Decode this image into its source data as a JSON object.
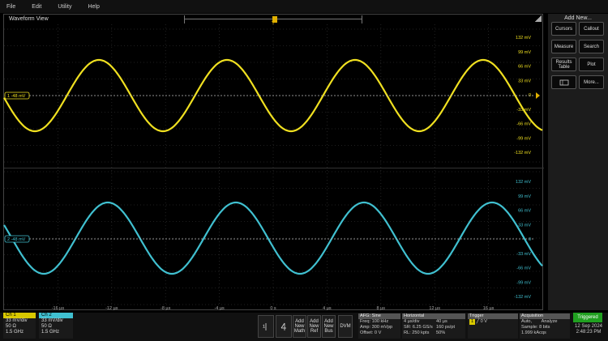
{
  "menu": [
    "File",
    "Edit",
    "Utility",
    "Help"
  ],
  "waveform_view": {
    "title": "Waveform View"
  },
  "ch1_axis": [
    "132 mV",
    "99 mV",
    "66 mV",
    "33 mV",
    "0",
    "-33 mV",
    "-66 mV",
    "-99 mV",
    "-132 mV"
  ],
  "ch2_axis": [
    "132 mV",
    "99 mV",
    "66 mV",
    "33 mV",
    "0",
    "-33 mV",
    "-66 mV",
    "-99 mV",
    "-132 mV"
  ],
  "time_axis": [
    "-16 µs",
    "-12 µs",
    "-8 µs",
    "-4 µs",
    "0 s",
    "4 µs",
    "8 µs",
    "12 µs",
    "16 µs"
  ],
  "ch1_marker": "1 -48 mV",
  "ch2_marker": "2 -48 mV",
  "trigger_marker": "T",
  "colors": {
    "ch1": "#f0e020",
    "ch2": "#40c0d0",
    "trigger": "#e0b000",
    "triggered": "#20a020"
  },
  "add_new": {
    "title": "Add New...",
    "buttons": [
      "Cursors",
      "Callout",
      "Measure",
      "Search",
      "Results Table",
      "Plot",
      "",
      "More..."
    ]
  },
  "ch1_badge": {
    "title": "Ch 1",
    "scale": "33 mV/div",
    "impedance": "50 Ω",
    "bw": "1.5 GHz"
  },
  "ch2_badge": {
    "title": "Ch 2",
    "scale": "33 mV/div",
    "impedance": "50 Ω",
    "bw": "1.5 GHz"
  },
  "bottom_buttons": [
    "Add New Math",
    "Add New Ref",
    "Add New Bus",
    "DVM"
  ],
  "afg": {
    "title": "AFG: Sine",
    "freq": "Freq: 100 kHz",
    "amp": "Amp: 300 mVpp",
    "offset": "Offset: 0 V"
  },
  "horizontal": {
    "title": "Horizontal",
    "scale": "4 µs/div",
    "sr": "SR: 6.25 GS/s",
    "rl": "RL: 250 kpts",
    "pos": "40 µs",
    "pts": "160 ps/pt",
    "pct": "50%"
  },
  "trigger": {
    "title": "Trigger",
    "source": "1",
    "level": "0 V"
  },
  "acquisition": {
    "title": "Acquisition",
    "mode": "Auto,",
    "analyze": "Analyze",
    "sample": "Sample: 8 bits",
    "acqs": "1.999 kAcqs"
  },
  "status": {
    "triggered": "Triggered",
    "date": "12 Sep 2024",
    "time": "2:48:23 PM"
  }
}
